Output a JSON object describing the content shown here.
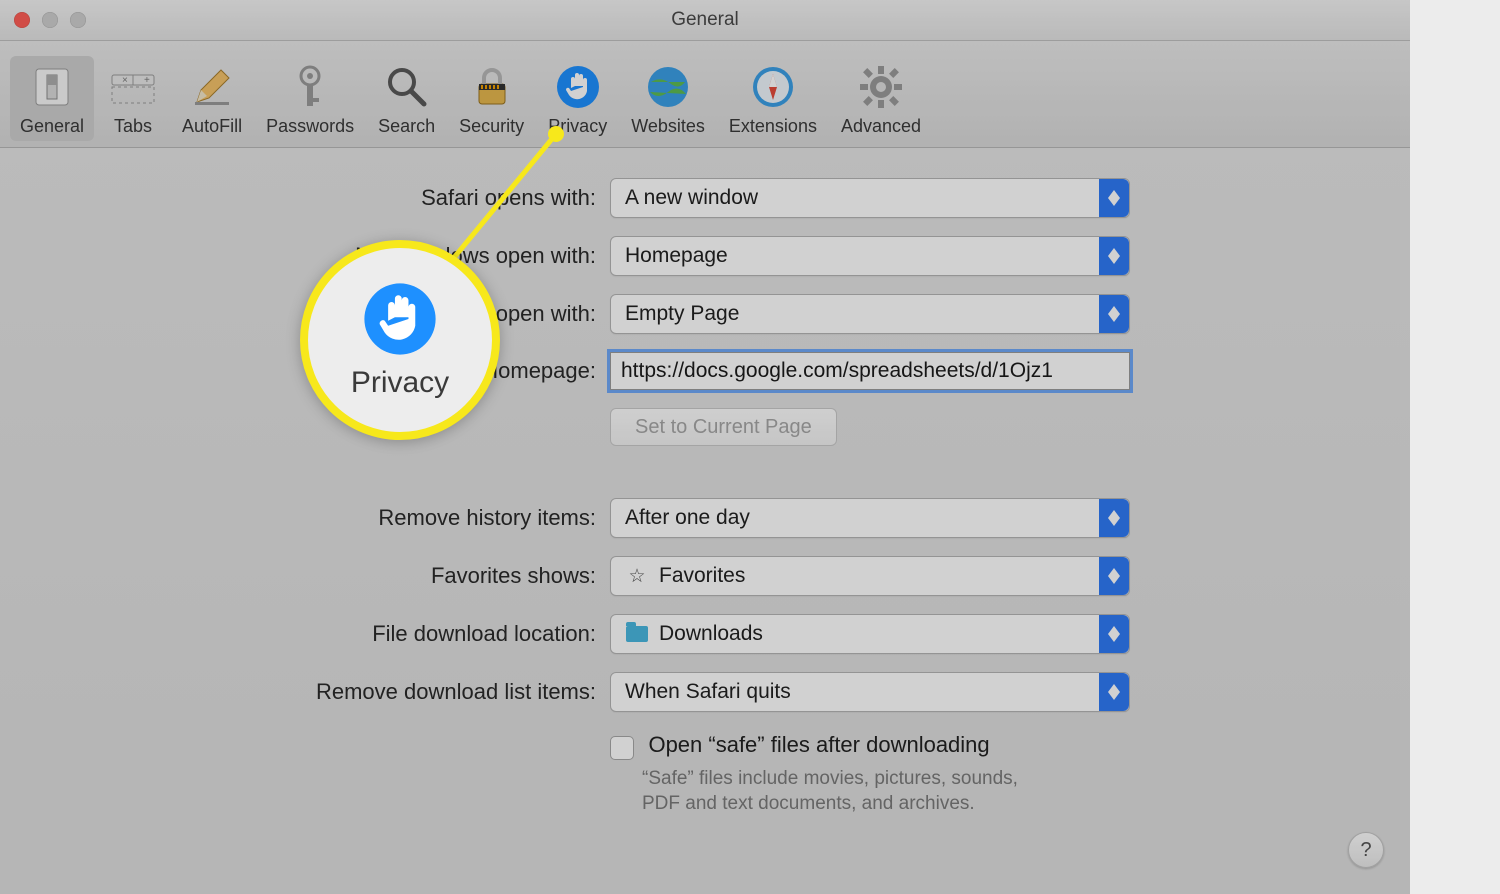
{
  "window": {
    "title": "General"
  },
  "toolbar": {
    "items": [
      {
        "id": "general",
        "label": "General"
      },
      {
        "id": "tabs",
        "label": "Tabs"
      },
      {
        "id": "autofill",
        "label": "AutoFill"
      },
      {
        "id": "passwords",
        "label": "Passwords"
      },
      {
        "id": "search",
        "label": "Search"
      },
      {
        "id": "security",
        "label": "Security"
      },
      {
        "id": "privacy",
        "label": "Privacy"
      },
      {
        "id": "websites",
        "label": "Websites"
      },
      {
        "id": "extensions",
        "label": "Extensions"
      },
      {
        "id": "advanced",
        "label": "Advanced"
      }
    ],
    "selected": "general"
  },
  "form": {
    "safari_opens_with": {
      "label": "Safari opens with:",
      "value": "A new window"
    },
    "new_windows_open": {
      "label": "New windows open with:",
      "value": "Homepage"
    },
    "new_tabs_open": {
      "label": "New tabs open with:",
      "value": "Empty Page"
    },
    "homepage": {
      "label": "Homepage:",
      "value": "https://docs.google.com/spreadsheets/d/1Ojz1"
    },
    "set_current_button": "Set to Current Page",
    "remove_history": {
      "label": "Remove history items:",
      "value": "After one day"
    },
    "favorites_shows": {
      "label": "Favorites shows:",
      "value": "Favorites"
    },
    "download_location": {
      "label": "File download location:",
      "value": "Downloads"
    },
    "remove_downloads": {
      "label": "Remove download list items:",
      "value": "When Safari quits"
    },
    "safe_files_checkbox": {
      "label": "Open “safe” files after downloading",
      "checked": false
    },
    "safe_files_help": "“Safe” files include movies, pictures, sounds, PDF and text documents, and archives."
  },
  "help_button": "?",
  "callout": {
    "label": "Privacy"
  }
}
